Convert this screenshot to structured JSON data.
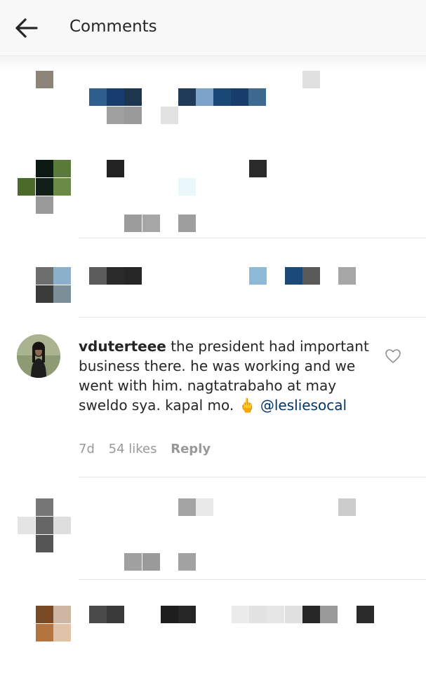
{
  "header": {
    "title": "Comments",
    "back_icon": "arrow-left-icon"
  },
  "comment": {
    "username": "vduterteee",
    "text_before_mention": " the president had important business there. he was working and we went with him. nagtatrabaho at may sweldo sya. kapal mo. 🖕",
    "mention": "@lesliesocal",
    "time": "7d",
    "likes": "54 likes",
    "reply_label": "Reply",
    "like_icon": "heart-outline-icon"
  },
  "colors": {
    "mention": "#003569",
    "meta": "#999999",
    "header_bg": "#f8f8f8"
  }
}
